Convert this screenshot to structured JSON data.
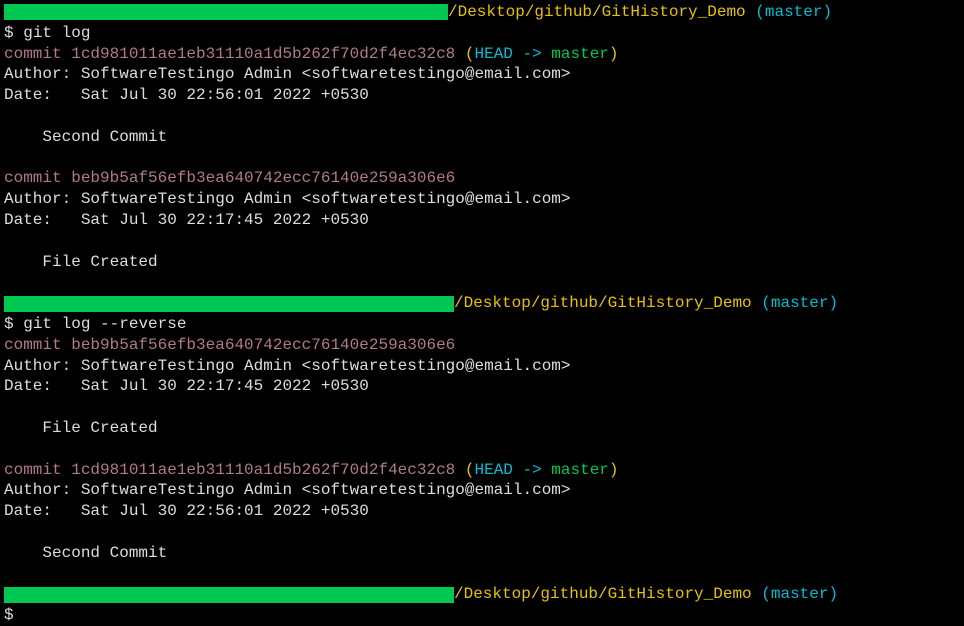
{
  "prompt": {
    "path": "/Desktop/github/GitHistory_Demo",
    "branch": "(master)",
    "dollar": "$"
  },
  "commands": {
    "gitlog": "git log",
    "gitlog_reverse": "git log --reverse"
  },
  "commits": {
    "c1": {
      "hash_line": "commit 1cd981011ae1eb31110a1d5b262f70d2f4ec32c8",
      "head_open": " (",
      "head_text": "HEAD -> ",
      "head_master": "master",
      "head_close": ")",
      "author": "Author: SoftwareTestingo Admin <softwaretestingo@email.com>",
      "date": "Date:   Sat Jul 30 22:56:01 2022 +0530",
      "message": "    Second Commit"
    },
    "c2": {
      "hash_line": "commit beb9b5af56efb3ea640742ecc76140e259a306e6",
      "author": "Author: SoftwareTestingo Admin <softwaretestingo@email.com>",
      "date": "Date:   Sat Jul 30 22:17:45 2022 +0530",
      "message": "    File Created"
    }
  }
}
